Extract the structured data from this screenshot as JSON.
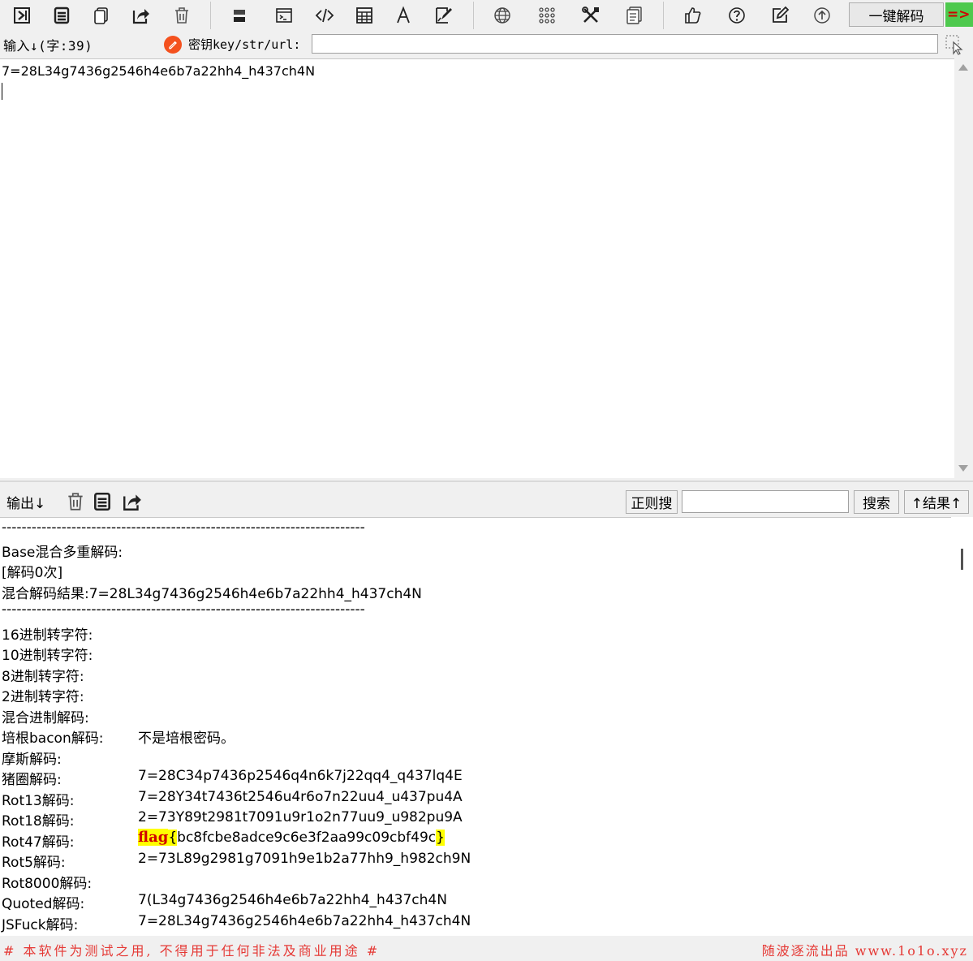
{
  "toolbar": {
    "decode_button": "一键解码",
    "indicator": "=>",
    "icons": [
      "import-icon",
      "copy-all-icon",
      "copy-icon",
      "share-icon",
      "trash-icon",
      "base64-icon",
      "console-icon",
      "code-icon",
      "table-icon",
      "font-icon",
      "sign-icon",
      "globe-icon",
      "grid-icon",
      "tools-icon",
      "document-icon",
      "thumbs-up-icon",
      "help-icon",
      "edit-icon",
      "upload-icon"
    ]
  },
  "input": {
    "label": "输入↓(字:39)",
    "key_label": "密钥key/str/url:",
    "key_value": "",
    "text": "7=28L34g7436g2546h4e6b7a22hh4_h437ch4N"
  },
  "output": {
    "label": "输出↓",
    "regex_button": "正则搜",
    "regex_value": "",
    "search_button": "搜索",
    "result_button": "↑结果↑",
    "lines": [
      {
        "label": "-------------------------------------------------------------------------",
        "value": ""
      },
      {
        "label": "Base混合多重解码:",
        "value": ""
      },
      {
        "label": "[解码0次]",
        "value": ""
      },
      {
        "label": "混合解码結果:7=28L34g7436g2546h4e6b7a22hh4_h437ch4N",
        "value": ""
      },
      {
        "label": "-------------------------------------------------------------------------",
        "value": ""
      },
      {
        "label": "16进制转字符:",
        "value": ""
      },
      {
        "label": "10进制转字符:",
        "value": ""
      },
      {
        "label": "8进制转字符:",
        "value": ""
      },
      {
        "label": "2进制转字符:",
        "value": ""
      },
      {
        "label": "混合进制解码:",
        "value": ""
      },
      {
        "label": "培根bacon解码:",
        "value": "不是培根密码。"
      },
      {
        "label": "摩斯解码:",
        "value": ""
      },
      {
        "label": "猪圈解码:",
        "value": "7=28C34p7436p2546q4n6k7j22qq4_q437lq4E"
      },
      {
        "label": "Rot13解码:",
        "value": "7=28Y34t7436t2546u4r6o7n22uu4_u437pu4A"
      },
      {
        "label": "Rot18解码:",
        "value": "2=73Y89t2981t7091u9r1o2n77uu9_u982pu9A"
      },
      {
        "label": "Rot47解码:",
        "value": ""
      },
      {
        "label": "Rot5解码:",
        "value": "2=73L89g2981g7091h9e1b2a77hh9_h982ch9N"
      },
      {
        "label": "Rot8000解码:",
        "value": ""
      },
      {
        "label": "Quoted解码:",
        "value": "7(L34g7436g2546h4e6b7a22hh4_h437ch4N"
      },
      {
        "label": "JSFuck解码:",
        "value": "7=28L34g7436g2546h4e6b7a22hh4_h437ch4N"
      }
    ],
    "rot47_flag": "flag",
    "rot47_brace_open": "{",
    "rot47_body": "bc8fcbe8adce9c6e3f2aa99c09cbf49c",
    "rot47_brace_close": "}"
  },
  "footer": {
    "left": "# 本软件为测试之用, 不得用于任何非法及商业用途 #",
    "right": "随波逐流出品 www.1o1o.xyz"
  },
  "colors": {
    "accent_red": "#e53935",
    "highlight": "#ffff00",
    "indicator_green": "#4ec94e"
  }
}
